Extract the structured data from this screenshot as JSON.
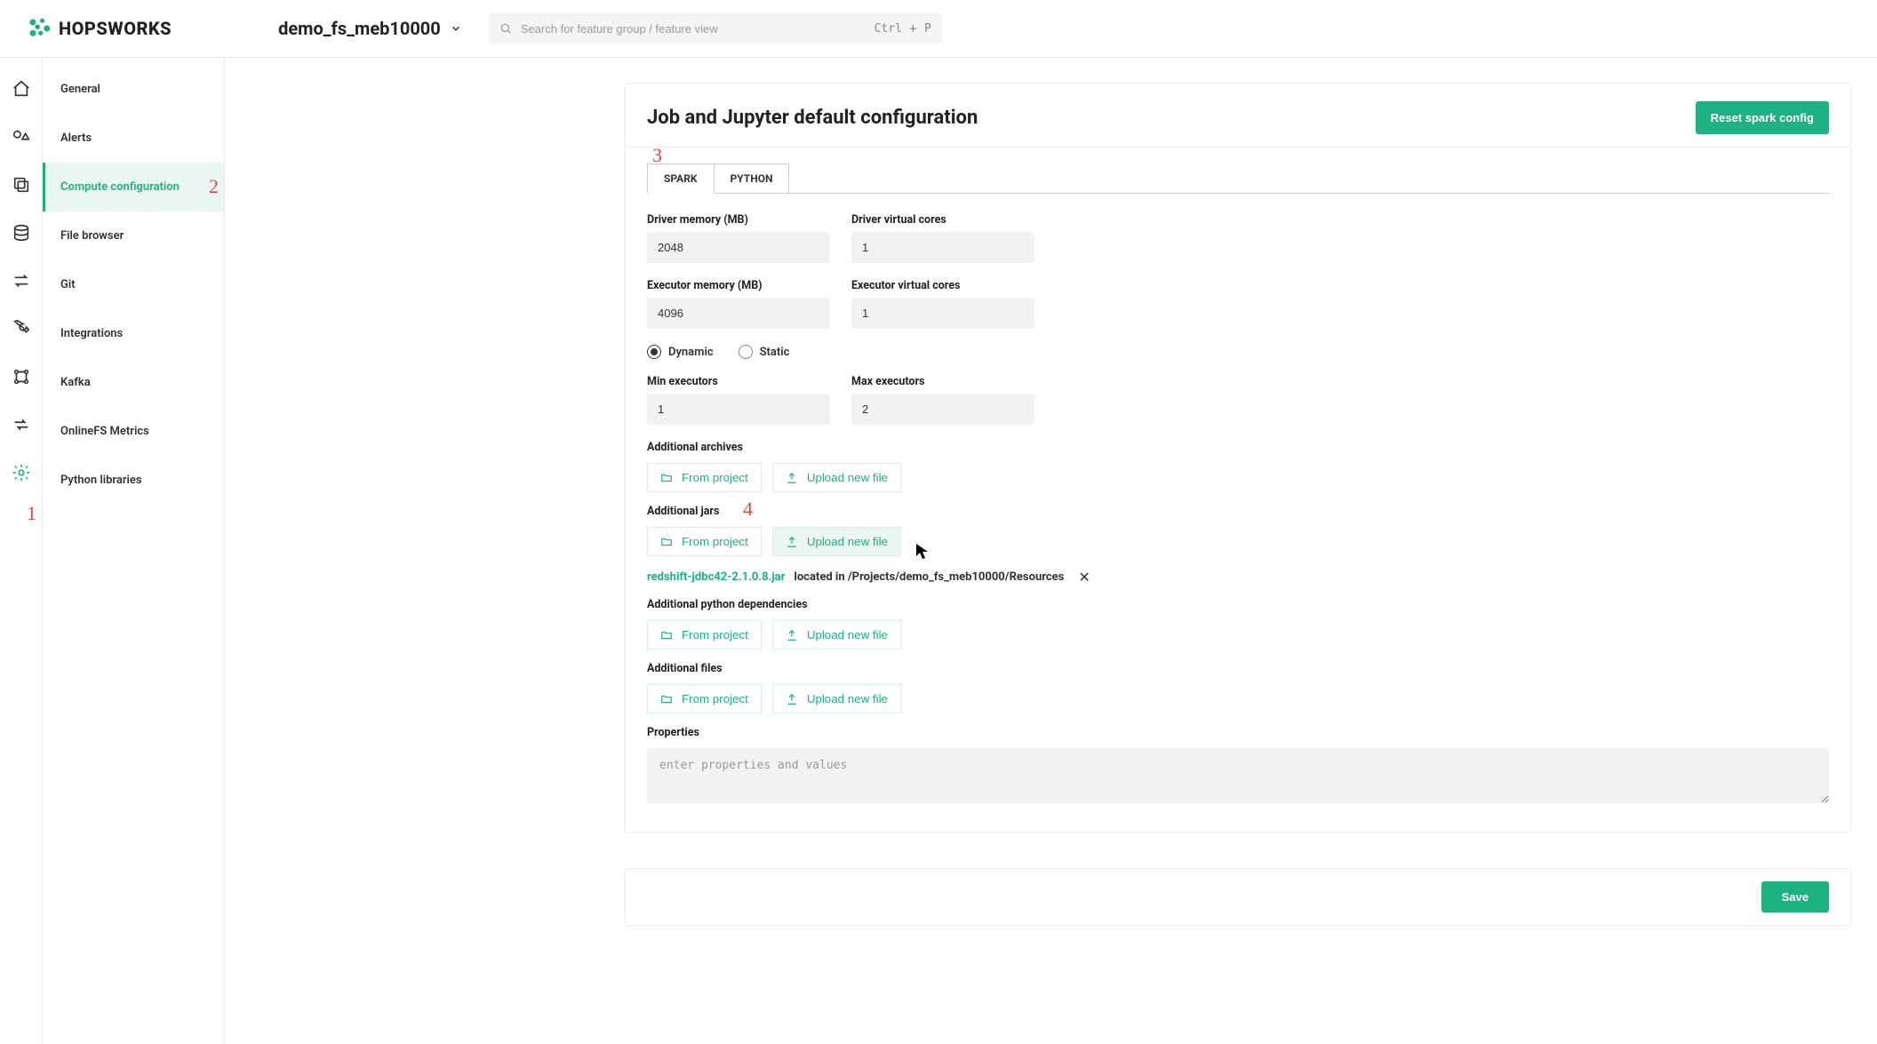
{
  "header": {
    "brand": "HOPSWORKS",
    "project": "demo_fs_meb10000",
    "search_placeholder": "Search for feature group / feature view",
    "kbd_ctrl": "Ctrl",
    "kbd_plus": "+",
    "kbd_p": "P"
  },
  "sidebar": {
    "items": [
      {
        "label": "General"
      },
      {
        "label": "Alerts"
      },
      {
        "label": "Compute configuration"
      },
      {
        "label": "File browser"
      },
      {
        "label": "Git"
      },
      {
        "label": "Integrations"
      },
      {
        "label": "Kafka"
      },
      {
        "label": "OnlineFS Metrics"
      },
      {
        "label": "Python libraries"
      }
    ]
  },
  "annotations": {
    "a1": "1",
    "a2": "2",
    "a3": "3",
    "a4": "4"
  },
  "page": {
    "title": "Job and Jupyter default configuration",
    "reset_btn": "Reset spark config",
    "tabs": {
      "spark": "SPARK",
      "python": "PYTHON"
    },
    "fields": {
      "driver_mem_label": "Driver memory (MB)",
      "driver_mem_value": "2048",
      "driver_cores_label": "Driver virtual cores",
      "driver_cores_value": "1",
      "exec_mem_label": "Executor memory (MB)",
      "exec_mem_value": "4096",
      "exec_cores_label": "Executor virtual cores",
      "exec_cores_value": "1",
      "alloc_dynamic": "Dynamic",
      "alloc_static": "Static",
      "min_exec_label": "Min executors",
      "min_exec_value": "1",
      "max_exec_label": "Max executors",
      "max_exec_value": "2"
    },
    "sections": {
      "archives": "Additional archives",
      "jars": "Additional jars",
      "pydeps": "Additional python dependencies",
      "files": "Additional files",
      "properties": "Properties"
    },
    "buttons": {
      "from_project": "From project",
      "upload_new": "Upload new file",
      "save": "Save"
    },
    "jar_file": {
      "name": "redshift-jdbc42-2.1.0.8.jar",
      "located_in": "located in",
      "path": "/Projects/demo_fs_meb10000/Resources"
    },
    "properties_placeholder": "enter properties and values"
  }
}
